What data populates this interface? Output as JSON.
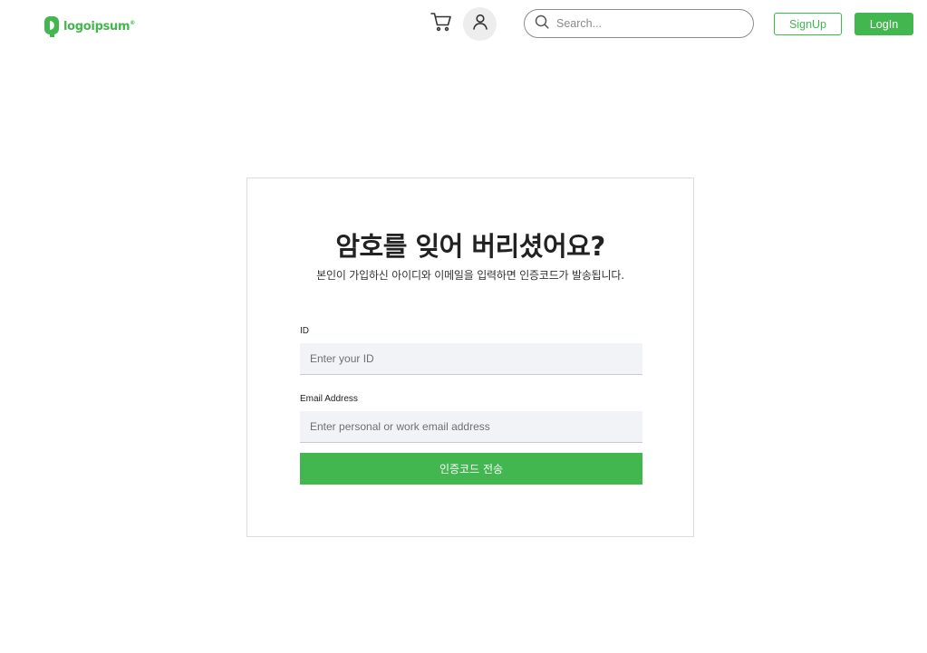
{
  "header": {
    "logo_text": "logoipsum",
    "logo_mark": "®",
    "search": {
      "placeholder": "Search...",
      "value": ""
    },
    "signup_label": "SignUp",
    "login_label": "LogIn",
    "icons": {
      "cart": "cart-icon",
      "user": "user-icon",
      "search": "search-icon"
    }
  },
  "form": {
    "title": "암호를 잊어 버리셨어요?",
    "subtitle": "본인이 가입하신 아이디와 이메일을 입력하면 인증코드가 발송됩니다.",
    "id_label": "ID",
    "id_placeholder": "Enter your ID",
    "email_label": "Email Address",
    "email_placeholder": "Enter personal or work email address",
    "submit_label": "인증코드 전송"
  },
  "colors": {
    "brand_green": "#43b74f",
    "input_bg": "#f2f3f7",
    "avatar_bg": "#ededed",
    "card_border": "#dcdcdc"
  }
}
